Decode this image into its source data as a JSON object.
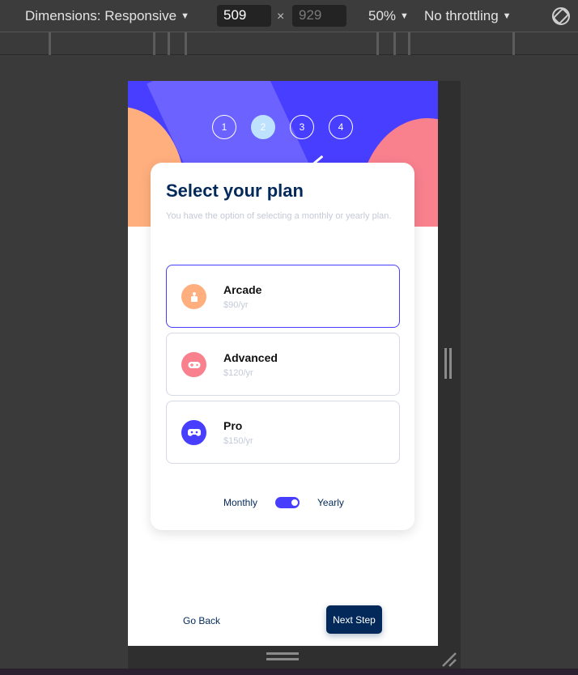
{
  "devtools": {
    "dimensions_label": "Dimensions: Responsive",
    "width_value": "509",
    "height_placeholder": "929",
    "times": "×",
    "zoom": "50%",
    "throttling": "No throttling",
    "caret": "▼"
  },
  "steps": [
    "1",
    "2",
    "3",
    "4"
  ],
  "active_step": 2,
  "form": {
    "title": "Select your plan",
    "subtitle": "You have the option of selecting a monthly or yearly plan."
  },
  "plans": [
    {
      "name": "Arcade",
      "price": "$90/yr",
      "icon": "arcade-icon",
      "color": "#ffaf7e",
      "selected": true
    },
    {
      "name": "Advanced",
      "price": "$120/yr",
      "icon": "gamepad-icon",
      "color": "#f9818e",
      "selected": false
    },
    {
      "name": "Pro",
      "price": "$150/yr",
      "icon": "controller-icon",
      "color": "#483eff",
      "selected": false
    }
  ],
  "billing": {
    "monthly_label": "Monthly",
    "yearly_label": "Yearly",
    "yearly_selected": true
  },
  "nav": {
    "back_label": "Go Back",
    "next_label": "Next Step"
  },
  "colors": {
    "primary": "#483eff",
    "marine": "#02295a",
    "orange": "#ffaf7e",
    "pink": "#f9818e",
    "light_blue": "#bee2fd",
    "gray": "#c5c9d8"
  }
}
